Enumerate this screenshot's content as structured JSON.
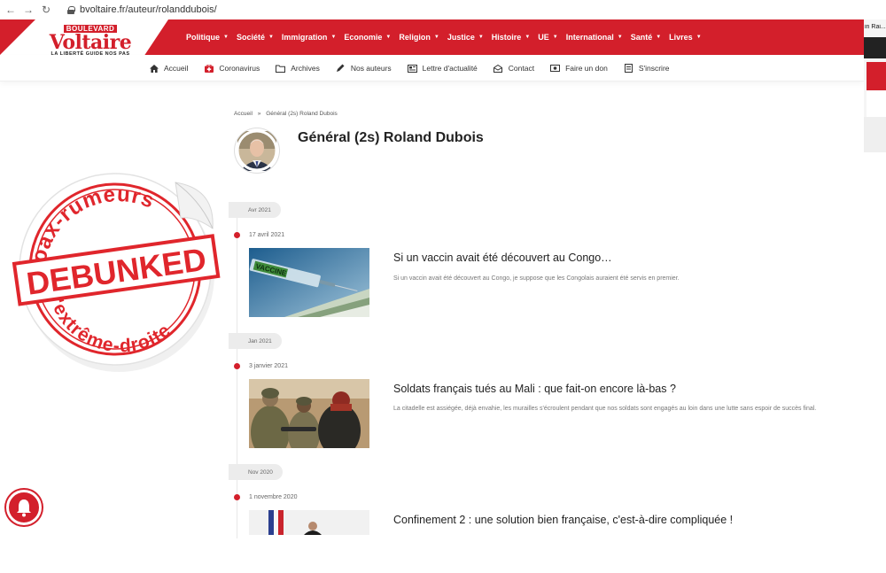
{
  "browser": {
    "url": "bvoltaire.fr/auteur/rolanddubois/"
  },
  "logo": {
    "boulevard": "BOULEVARD",
    "voltaire": "Voltaire",
    "tagline": "LA LIBERTÉ GUIDE NOS PAS"
  },
  "main_menu": [
    {
      "label": "Politique"
    },
    {
      "label": "Société"
    },
    {
      "label": "Immigration"
    },
    {
      "label": "Economie"
    },
    {
      "label": "Religion"
    },
    {
      "label": "Justice"
    },
    {
      "label": "Histoire"
    },
    {
      "label": "UE"
    },
    {
      "label": "International"
    },
    {
      "label": "Santé"
    },
    {
      "label": "Livres"
    }
  ],
  "secondary_nav": [
    {
      "label": "Accueil",
      "icon": "home-icon"
    },
    {
      "label": "Coronavirus",
      "icon": "medkit-icon"
    },
    {
      "label": "Archives",
      "icon": "folder-icon"
    },
    {
      "label": "Nos auteurs",
      "icon": "pen-icon"
    },
    {
      "label": "Lettre d'actualité",
      "icon": "newspaper-icon"
    },
    {
      "label": "Contact",
      "icon": "envelope-icon"
    },
    {
      "label": "Faire un don",
      "icon": "money-icon"
    },
    {
      "label": "S'inscrire",
      "icon": "form-icon"
    }
  ],
  "right_panel": {
    "text": "in Rai..."
  },
  "breadcrumb": {
    "home": "Accueil",
    "separator": "»",
    "current": "Général (2s) Roland Dubois"
  },
  "author": {
    "name": "Général (2s) Roland Dubois"
  },
  "timeline": [
    {
      "month": "Avr 2021",
      "date": "17 avril 2021",
      "title": "Si un vaccin avait été découvert au Congo…",
      "excerpt": "Si un vaccin avait été découvert au Congo, je suppose que les Congolais auraient été servis en premier.",
      "thumb_label": "VACCINE"
    },
    {
      "month": "Jan 2021",
      "date": "3 janvier 2021",
      "title": "Soldats français tués au Mali : que fait-on encore là-bas ?",
      "excerpt": "La citadelle est assiégée, déjà envahie, les murailles s'écroulent pendant que nos soldats sont engagés au loin dans une lutte sans espoir de succès final."
    },
    {
      "month": "Nov 2020",
      "date": "1 novembre 2020",
      "title": "Confinement 2 : une solution bien française, c'est-à-dire compliquée !"
    }
  ],
  "stamp": {
    "top_arc": "Hoax-rumeurs",
    "center": "DEBUNKED",
    "bottom_arc": "d'extrême-droite"
  },
  "colors": {
    "brand_red": "#d31f2b",
    "stamp_red": "#e0262c"
  }
}
